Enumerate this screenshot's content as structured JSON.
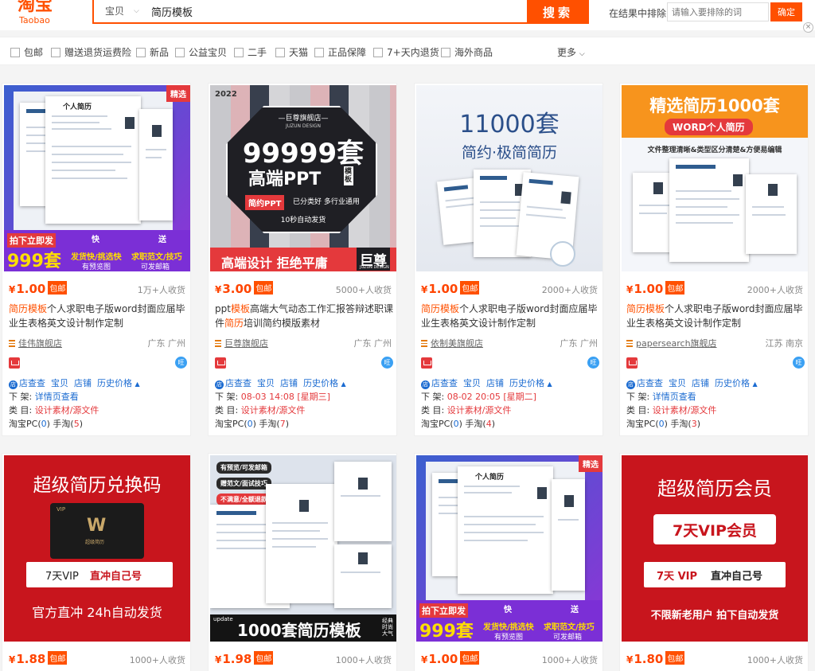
{
  "header": {
    "logo_cn": "淘宝",
    "logo_en": "Taobao",
    "search_type": "宝贝",
    "search_query": "简历模板",
    "search_button": "搜索",
    "exclude_label": "在结果中排除",
    "exclude_placeholder": "请输入要排除的词",
    "exclude_button": "确定",
    "close_glyph": "×"
  },
  "filters": {
    "items": [
      "包邮",
      "赠送退货运费险",
      "新品",
      "公益宝贝",
      "二手",
      "天猫",
      "正品保障",
      "7+天内退货",
      "海外商品"
    ],
    "more": "更多"
  },
  "labels": {
    "baoyou": "包邮",
    "yen": "¥",
    "plugin_links": [
      "店查查",
      "宝贝",
      "店铺",
      "历史价格"
    ],
    "shelf_label": "下 架:",
    "category_label": "类 目:",
    "counts_pc": "淘宝PC(",
    "counts_mobile": ") 手淘(",
    "counts_close": ")",
    "ww": "旺"
  },
  "products": [
    {
      "price": "1.00",
      "sales": "1万+人收货",
      "title_hl": "简历模板",
      "title_rest": "个人求职电子版word封面应届毕业生表格英文设计制作定制",
      "shop": "佳伟旗舰店",
      "location": "广东 广州",
      "shelf": "详情页查看",
      "shelf_red": false,
      "category": "设计素材/源文件",
      "pc": "0",
      "mobile": "5",
      "thumb": {
        "tag": "精选",
        "promo1": "拍下立即发",
        "promo2": "999套",
        "promo3": "发货快/挑选快",
        "promo4": "有预览图",
        "promo5": "快",
        "promo6": "求职范文/技巧",
        "promo7": "可发邮箱",
        "promo8": "送",
        "sheet": "个人简历"
      }
    },
    {
      "price": "3.00",
      "sales": "5000+人收货",
      "title_pre": "ppt",
      "title_hl": "模板",
      "title_rest": "高端大气动态工作汇报答辩述职课件",
      "title_hl2": "简历",
      "title_rest2": "培训简约模版素材",
      "shop": "巨尊旗舰店",
      "location": "广东 广州",
      "shelf": "08-03 14:08 [星期三]",
      "shelf_red": true,
      "category": "设计素材/源文件",
      "pc": "0",
      "mobile": "7",
      "thumb": {
        "year": "2022",
        "shop": "—巨尊旗舰店—",
        "design": "JUZUN DESIGN",
        "big": "99999套",
        "ppt": "高端PPT",
        "mb": "模板",
        "tag1": "简约PPT",
        "tag2": "已分类好 多行业通用",
        "send": "10秒自动发货",
        "bottom": "高端设计 拒绝平庸",
        "brand": "巨尊",
        "brand_en": "JUZUN DESIGN"
      }
    },
    {
      "price": "1.00",
      "sales": "2000+人收货",
      "title_hl": "简历模板",
      "title_rest": "个人求职电子版word封面应届毕业生表格英文设计制作定制",
      "shop": "依制美旗舰店",
      "location": "广东 广州",
      "shelf": "08-02 20:05 [星期二]",
      "shelf_red": true,
      "category": "设计素材/源文件",
      "pc": "0",
      "mobile": "4",
      "thumb": {
        "big": "11000套",
        "sub": "简约·极简简历"
      }
    },
    {
      "price": "1.00",
      "sales": "2000+人收货",
      "title_hl": "简历模板",
      "title_rest": "个人求职电子版word封面应届毕业生表格英文设计制作定制",
      "shop": "papersearch旗舰店",
      "location": "江苏 南京",
      "shelf": "详情页查看",
      "shelf_red": false,
      "category": "设计素材/源文件",
      "pc": "0",
      "mobile": "3",
      "thumb": {
        "big": "精选简历1000套",
        "word": "WORD个人简历",
        "sub": "文件整理清晰&类型区分清楚&方便易编辑"
      }
    },
    {
      "price": "1.88",
      "sales": "1000+人收货",
      "thumb": {
        "big": "超级简历兑换码",
        "vip": "VIP",
        "card": "超级简历",
        "line1a": "7天VIP",
        "line1b": "直冲自己号",
        "line2": "官方直冲 24h自动发货"
      }
    },
    {
      "price": "1.98",
      "sales": "1000+人收货",
      "thumb": {
        "tag1": "有预览/可发邮箱",
        "tag2": "赠范文/面试技巧",
        "tag3": "不满意/全额退款",
        "update": "update",
        "big": "1000套简历模板",
        "side": "经典时尚大气"
      }
    },
    {
      "price": "1.00",
      "sales": "1000+人收货",
      "thumb": {
        "tag": "精选",
        "promo1": "拍下立即发",
        "promo2": "999套",
        "promo3": "发货快/挑选快",
        "promo4": "有预览图",
        "promo5": "快",
        "promo6": "求职范文/技巧",
        "promo7": "可发邮箱",
        "promo8": "送",
        "sheet": "个人简历"
      }
    },
    {
      "price": "1.80",
      "sales": "1000+人收货",
      "thumb": {
        "big": "超级简历会员",
        "vip": "7天VIP会员",
        "line1a": "7天 VIP",
        "line1b": "直冲自己号",
        "line2": "不限新老用户 拍下自动发货"
      }
    }
  ]
}
